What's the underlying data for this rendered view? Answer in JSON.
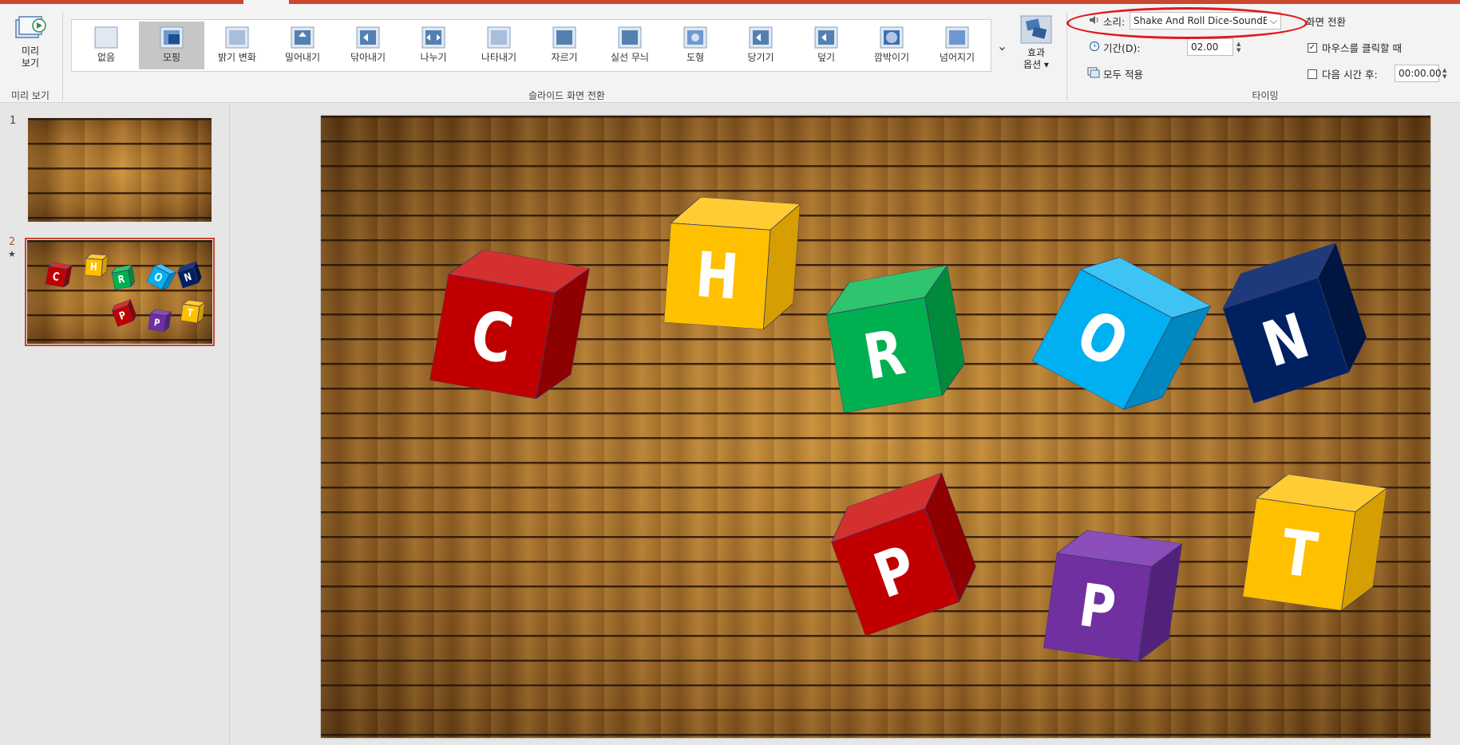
{
  "ribbon": {
    "preview": {
      "label_line1": "미리",
      "label_line2": "보기",
      "group_label": "미리 보기"
    },
    "transitions": {
      "group_label": "슬라이드 화면 전환",
      "items": [
        {
          "label": "없음",
          "icon": "none-transition-icon"
        },
        {
          "label": "모핑",
          "icon": "morph-transition-icon",
          "selected": true
        },
        {
          "label": "밝기 변화",
          "icon": "fade-transition-icon"
        },
        {
          "label": "밀어내기",
          "icon": "push-transition-icon"
        },
        {
          "label": "닦아내기",
          "icon": "wipe-transition-icon"
        },
        {
          "label": "나누기",
          "icon": "split-transition-icon"
        },
        {
          "label": "나타내기",
          "icon": "reveal-transition-icon"
        },
        {
          "label": "자르기",
          "icon": "cut-transition-icon"
        },
        {
          "label": "실선 무늬",
          "icon": "random-bars-transition-icon"
        },
        {
          "label": "도형",
          "icon": "shape-transition-icon"
        },
        {
          "label": "당기기",
          "icon": "uncover-transition-icon"
        },
        {
          "label": "덮기",
          "icon": "cover-transition-icon"
        },
        {
          "label": "깜박이기",
          "icon": "flash-transition-icon"
        },
        {
          "label": "넘어지기",
          "icon": "fall-over-transition-icon"
        }
      ]
    },
    "effect_options": {
      "line1": "효과",
      "line2": "옵션 ▾"
    },
    "timing": {
      "group_label": "타이밍",
      "sound_label": "소리:",
      "sound_value": "Shake And Roll Dice-SoundBibl...",
      "duration_label": "기간(D):",
      "duration_value": "02.00",
      "apply_all_label": "모두 적용",
      "advance_header": "화면 전환",
      "on_click_label": "마우스를 클릭할 때",
      "on_click_checked": true,
      "after_label": "다음 시간 후:",
      "after_checked": false,
      "after_value": "00:00.00"
    }
  },
  "slides": [
    {
      "number": "1",
      "marker": ""
    },
    {
      "number": "2",
      "marker": "★"
    }
  ],
  "main_slide": {
    "cubes": [
      {
        "letter": "C",
        "color": "#c00000",
        "dark": "#8f0000",
        "top": "#d43030"
      },
      {
        "letter": "H",
        "color": "#ffc000",
        "dark": "#d69e00",
        "top": "#ffcd33"
      },
      {
        "letter": "R",
        "color": "#00b050",
        "dark": "#008a3c",
        "top": "#2fc46e"
      },
      {
        "letter": "O",
        "color": "#00b0f0",
        "dark": "#0088c0",
        "top": "#3dc4f5"
      },
      {
        "letter": "N",
        "color": "#002060",
        "dark": "#001540",
        "top": "#1e3a7a"
      },
      {
        "letter": "P",
        "color": "#c00000",
        "dark": "#8f0000",
        "top": "#d43030"
      },
      {
        "letter": "P",
        "color": "#7030a0",
        "dark": "#52227a",
        "top": "#8a4dba"
      },
      {
        "letter": "T",
        "color": "#ffc000",
        "dark": "#d69e00",
        "top": "#ffcd33"
      }
    ]
  }
}
